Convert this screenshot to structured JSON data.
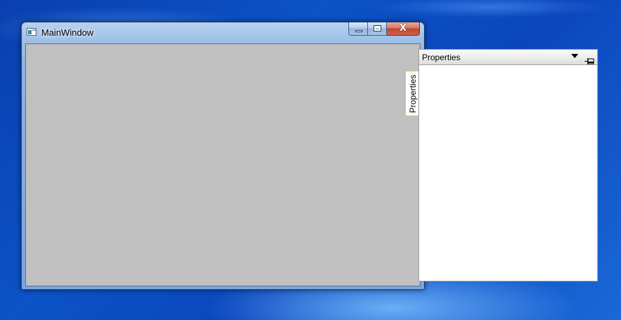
{
  "main_window": {
    "title": "MainWindow",
    "close_glyph": "X",
    "side_tab_label": "Properties"
  },
  "properties_pane": {
    "title": "Properties"
  },
  "icons": {
    "app": "app-window-icon",
    "minimize": "minimize-icon",
    "maximize": "maximize-icon",
    "close": "close-icon",
    "dropdown": "chevron-down-icon",
    "pin": "pin-icon"
  },
  "colors": {
    "client_background": "#c0c0c0",
    "tab_border": "#e6c155",
    "close_button": "#c2452e"
  }
}
